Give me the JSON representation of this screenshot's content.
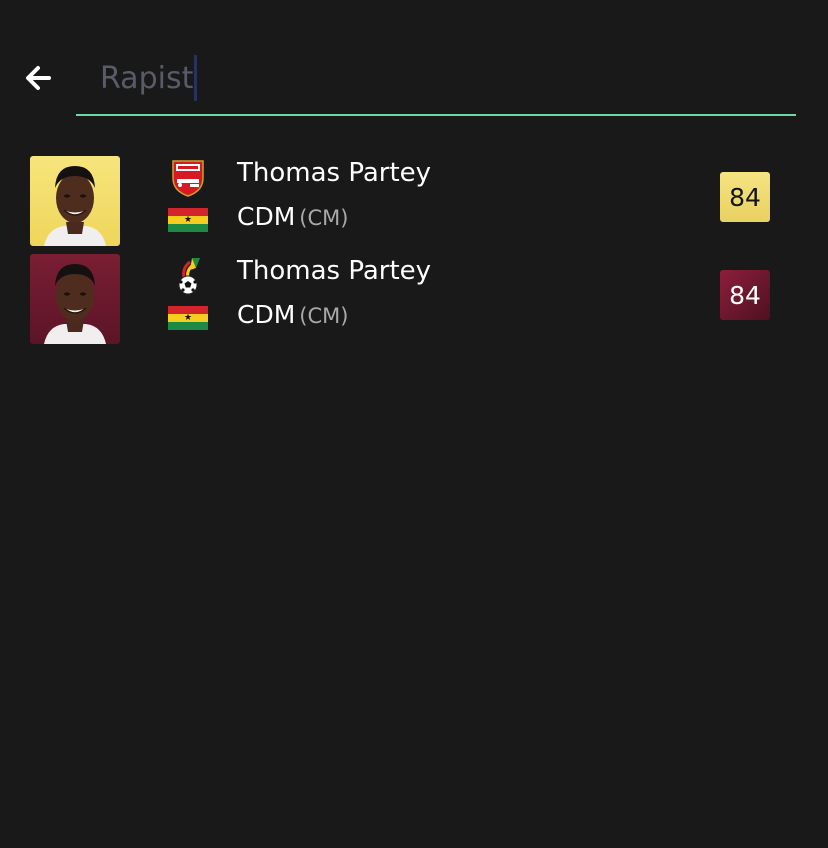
{
  "header": {
    "back_icon": "arrow-left-icon",
    "search": {
      "value": "Rapist",
      "placeholder": "",
      "underline_color": "#6fd7a6"
    }
  },
  "results": [
    {
      "name": "Thomas Partey",
      "position": "CDM",
      "alt_position": "(CM)",
      "rating": "84",
      "club_icon": "arsenal-crest-icon",
      "nation_icon": "ghana-flag-icon",
      "card_color": "#efd65a"
    },
    {
      "name": "Thomas Partey",
      "position": "CDM",
      "alt_position": "(CM)",
      "rating": "84",
      "club_icon": "ghana-fa-crest-icon",
      "nation_icon": "ghana-flag-icon",
      "card_color": "#7a1e33"
    }
  ]
}
